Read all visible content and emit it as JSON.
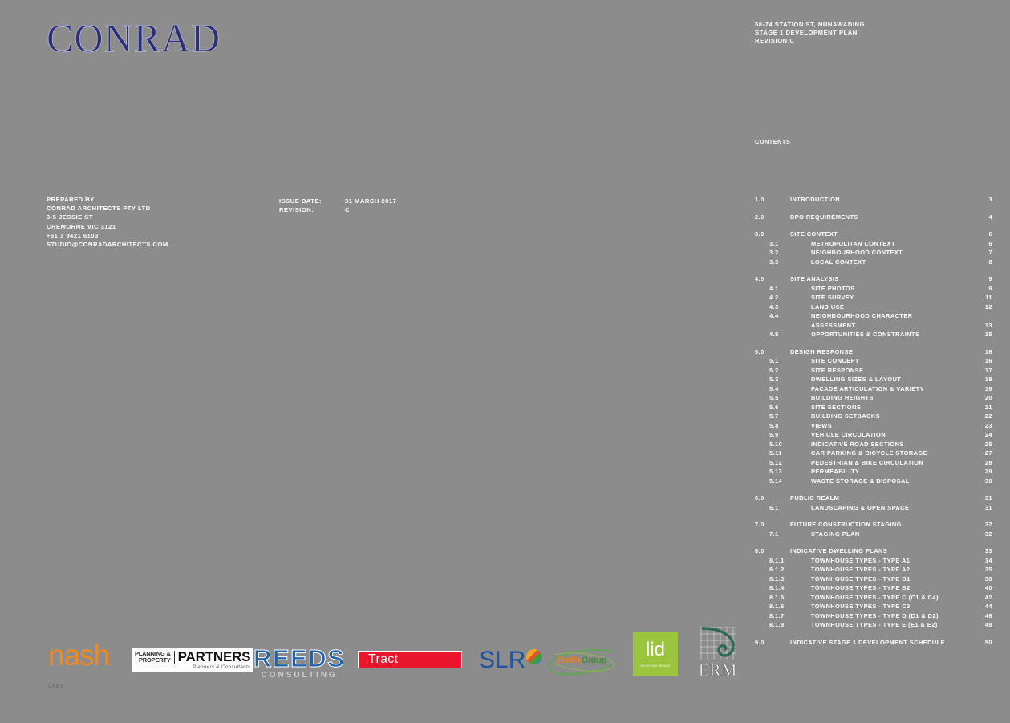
{
  "brand": {
    "logo_text": "CONRAD"
  },
  "header": {
    "line1": "58-74 STATION ST, NUNAWADING",
    "line2": "STAGE 1 DEVELOPMENT PLAN",
    "line3": "REVISION C"
  },
  "prepared": {
    "heading": "PREPARED BY:",
    "company": "CONRAD ARCHITECTS PTY LTD",
    "street": "3-5 JESSIE ST",
    "suburb": "CREMORNE VIC 3121",
    "phone": "+61 3 9421 6103",
    "email": "STUDIO@CONRADARCHITECTS.COM"
  },
  "issue": {
    "date_label": "ISSUE DATE:",
    "date_value": "31 MARCH 2017",
    "revision_label": "REVISION:",
    "revision_value": "C"
  },
  "contents": {
    "title": "CONTENTS",
    "groups": [
      {
        "rows": [
          {
            "num": "1.0",
            "label": "INTRODUCTION",
            "page": "3",
            "level": 1
          }
        ]
      },
      {
        "rows": [
          {
            "num": "2.0",
            "label": "DPO REQUIREMENTS",
            "page": "4",
            "level": 1
          }
        ]
      },
      {
        "rows": [
          {
            "num": "3.0",
            "label": "SITE CONTEXT",
            "page": "6",
            "level": 1
          },
          {
            "num": "3.1",
            "label": "METROPOLITAN CONTEXT",
            "page": "6",
            "level": 2
          },
          {
            "num": "3.2",
            "label": "NEIGHBOURHOOD CONTEXT",
            "page": "7",
            "level": 2
          },
          {
            "num": "3.3",
            "label": "LOCAL CONTEXT",
            "page": "8",
            "level": 2
          }
        ]
      },
      {
        "rows": [
          {
            "num": "4.0",
            "label": "SITE ANALYSIS",
            "page": "9",
            "level": 1
          },
          {
            "num": "4.1",
            "label": "SITE PHOTOS",
            "page": "9",
            "level": 2
          },
          {
            "num": "4.2",
            "label": "SITE SURVEY",
            "page": "11",
            "level": 2
          },
          {
            "num": "4.3",
            "label": "LAND USE",
            "page": "12",
            "level": 2
          },
          {
            "num": "4.4",
            "label": "NEIGHBOURHOOD CHARACTER",
            "page": "",
            "level": 2
          },
          {
            "num": "",
            "label": "ASSESSMENT",
            "page": "13",
            "level": 2
          },
          {
            "num": "4.5",
            "label": "OPPORTUNITIES & CONSTRAINTS",
            "page": "15",
            "level": 2
          }
        ]
      },
      {
        "rows": [
          {
            "num": "5.0",
            "label": "DESIGN RESPONSE",
            "page": "16",
            "level": 1
          },
          {
            "num": "5.1",
            "label": "SITE CONCEPT",
            "page": "16",
            "level": 2
          },
          {
            "num": "5.2",
            "label": "SITE RESPONSE",
            "page": "17",
            "level": 2
          },
          {
            "num": "5.3",
            "label": "DWELLING SIZES & LAYOUT",
            "page": "18",
            "level": 2
          },
          {
            "num": "5.4",
            "label": "FACADE ARTICULATION & VARIETY",
            "page": "19",
            "level": 2
          },
          {
            "num": "5.5",
            "label": "BUILDING HEIGHTS",
            "page": "20",
            "level": 2
          },
          {
            "num": "5.6",
            "label": "SITE SECTIONS",
            "page": "21",
            "level": 2
          },
          {
            "num": "5.7",
            "label": "BUILDING SETBACKS",
            "page": "22",
            "level": 2
          },
          {
            "num": "5.8",
            "label": "VIEWS",
            "page": "23",
            "level": 2
          },
          {
            "num": "5.9",
            "label": "VEHICLE CIRCULATION",
            "page": "24",
            "level": 2
          },
          {
            "num": "5.10",
            "label": "INDICATIVE ROAD SECTIONS",
            "page": "25",
            "level": 2
          },
          {
            "num": "5.11",
            "label": "CAR PARKING & BICYCLE STORAGE",
            "page": "27",
            "level": 2
          },
          {
            "num": "5.12",
            "label": "PEDESTRIAN & BIKE CIRCULATION",
            "page": "28",
            "level": 2
          },
          {
            "num": "5.13",
            "label": "PERMEABILITY",
            "page": "29",
            "level": 2
          },
          {
            "num": "5.14",
            "label": "WASTE STORAGE & DISPOSAL",
            "page": "30",
            "level": 2
          }
        ]
      },
      {
        "rows": [
          {
            "num": "6.0",
            "label": "PUBLIC REALM",
            "page": "31",
            "level": 1
          },
          {
            "num": "6.1",
            "label": "LANDSCAPING & OPEN SPACE",
            "page": "31",
            "level": 2
          }
        ]
      },
      {
        "rows": [
          {
            "num": "7.0",
            "label": "FUTURE CONSTRUCTION STAGING",
            "page": "32",
            "level": 1
          },
          {
            "num": "7.1",
            "label": "STAGING PLAN",
            "page": "32",
            "level": 2
          }
        ]
      },
      {
        "rows": [
          {
            "num": "8.0",
            "label": "INDICATIVE DWELLING PLANS",
            "page": "33",
            "level": 1
          },
          {
            "num": "8.1.1",
            "label": "TOWNHOUSE TYPES - TYPE A1",
            "page": "34",
            "level": 3
          },
          {
            "num": "8.1.2",
            "label": "TOWNHOUSE TYPES - TYPE A2",
            "page": "35",
            "level": 3
          },
          {
            "num": "8.1.3",
            "label": "TOWNHOUSE TYPES - TYPE B1",
            "page": "38",
            "level": 3
          },
          {
            "num": "8.1.4",
            "label": "TOWNHOUSE TYPES - TYPE B2",
            "page": "40",
            "level": 3
          },
          {
            "num": "8.1.5",
            "label": "TOWNHOUSE TYPES - TYPE C (C1 & C4)",
            "page": "42",
            "level": 3
          },
          {
            "num": "8.1.6",
            "label": "TOWNHOUSE TYPES - TYPE C3",
            "page": "44",
            "level": 3
          },
          {
            "num": "8.1.7",
            "label": "TOWNHOUSE TYPES - TYPE D (D1 & D2)",
            "page": "46",
            "level": 3
          },
          {
            "num": "8.1.8",
            "label": "TOWNHOUSE TYPES - TYPE E (E1 & E2)",
            "page": "48",
            "level": 3
          }
        ]
      },
      {
        "rows": [
          {
            "num": "9.0",
            "label": "INDICATIVE STAGE 1 DEVELOPMENT SCHEDULE",
            "page": "50",
            "level": 1
          }
        ]
      }
    ]
  },
  "consultants": {
    "nash": {
      "word": "nash",
      "sub": "LABS"
    },
    "planning_partners": {
      "left_line1": "PLANNING &",
      "left_line2": "PROPERTY",
      "right": "PARTNERS",
      "tagline": "Planners & Consultants"
    },
    "reeds": {
      "word": "REEDS",
      "sub": "CONSULTING"
    },
    "tract": {
      "word": "Tract"
    },
    "slr": {
      "word": "SLR"
    },
    "traffix": {
      "part1": "Traffix",
      "part2": "Group"
    },
    "lid": {
      "word": "lid",
      "sub": "landscape design"
    },
    "erm": {
      "word": "ERM"
    }
  },
  "colors": {
    "background": "#8c8c8c",
    "brand_navy": "#2b2f7a",
    "nash_orange": "#f08a1e",
    "tract_red": "#e8152b",
    "reeds_blue": "#1d63b0",
    "slr_blue": "#2154a0",
    "lid_green": "#9ac43c"
  }
}
